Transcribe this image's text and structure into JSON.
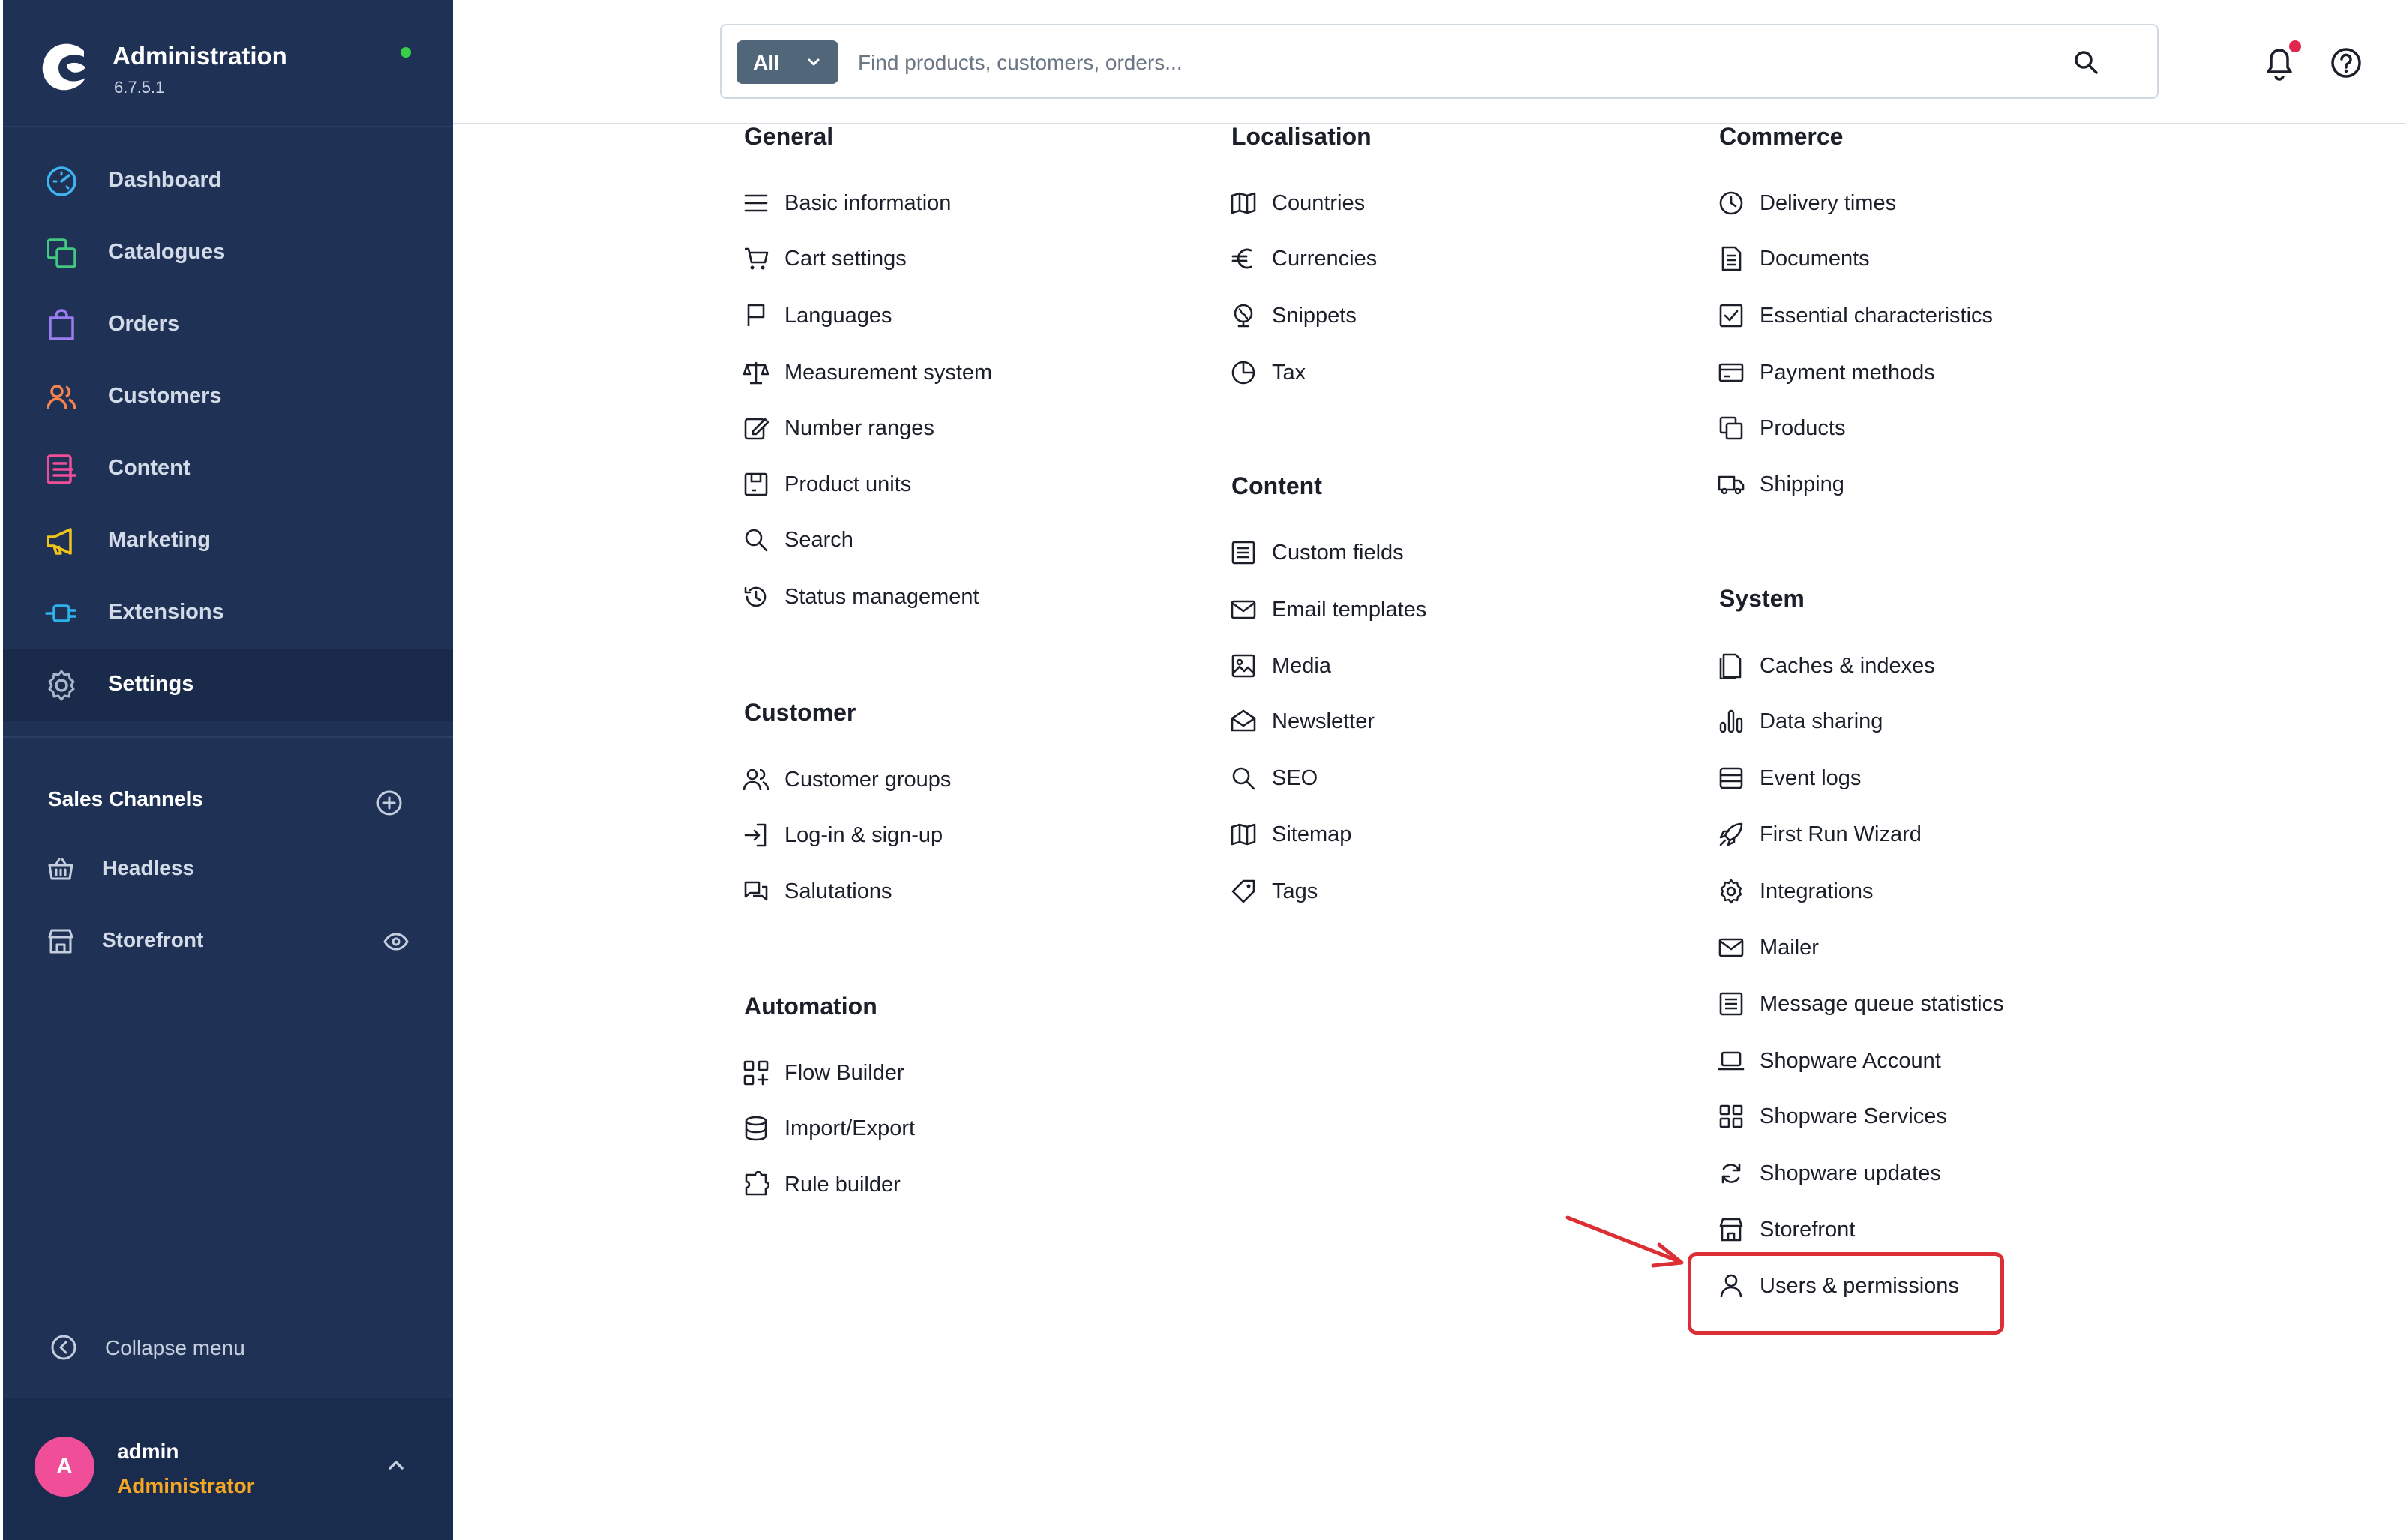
{
  "app": {
    "title": "Administration",
    "version": "6.7.5.1",
    "status_color": "#37d046",
    "logo_icon": "shopware-logo-icon"
  },
  "nav": {
    "items": [
      {
        "label": "Dashboard",
        "icon": "speedometer-icon",
        "color": "#3fb4f0"
      },
      {
        "label": "Catalogues",
        "icon": "catalogue-icon",
        "color": "#43c87f"
      },
      {
        "label": "Orders",
        "icon": "shopping-bag-icon",
        "color": "#9b7cf1"
      },
      {
        "label": "Customers",
        "icon": "users-icon",
        "color": "#f5834f"
      },
      {
        "label": "Content",
        "icon": "content-icon",
        "color": "#f04e98"
      },
      {
        "label": "Marketing",
        "icon": "megaphone-icon",
        "color": "#f0c518"
      },
      {
        "label": "Extensions",
        "icon": "plug-icon",
        "color": "#2db3ea"
      },
      {
        "label": "Settings",
        "icon": "gear-icon",
        "color": "#a9b5c9",
        "active": true
      }
    ]
  },
  "sales_channels": {
    "title": "Sales Channels",
    "add_icon": "plus-circle-icon",
    "items": [
      {
        "label": "Headless",
        "icon": "basket-icon"
      },
      {
        "label": "Storefront",
        "icon": "storefront-icon",
        "trailing_icon": "eye-icon"
      }
    ]
  },
  "collapse": {
    "label": "Collapse menu",
    "icon": "chevron-left-circle-icon"
  },
  "user": {
    "initial": "A",
    "name": "admin",
    "role": "Administrator",
    "avatar_color": "#f04e98",
    "role_color": "#f5a623"
  },
  "search": {
    "scope": "All",
    "placeholder": "Find products, customers, orders...",
    "value": ""
  },
  "header_icons": {
    "notifications": "bell-icon",
    "help": "help-icon"
  },
  "sections": {
    "general": {
      "title": "General",
      "items": [
        {
          "label": "Basic information",
          "icon": "menu-lines-icon"
        },
        {
          "label": "Cart settings",
          "icon": "cart-icon"
        },
        {
          "label": "Languages",
          "icon": "flag-icon"
        },
        {
          "label": "Measurement system",
          "icon": "scales-icon"
        },
        {
          "label": "Number ranges",
          "icon": "edit-note-icon"
        },
        {
          "label": "Product units",
          "icon": "product-box-icon"
        },
        {
          "label": "Search",
          "icon": "search-icon"
        },
        {
          "label": "Status management",
          "icon": "history-icon"
        }
      ]
    },
    "customer": {
      "title": "Customer",
      "items": [
        {
          "label": "Customer groups",
          "icon": "user-group-icon"
        },
        {
          "label": "Log-in & sign-up",
          "icon": "sign-in-icon"
        },
        {
          "label": "Salutations",
          "icon": "chat-bubbles-icon"
        }
      ]
    },
    "automation": {
      "title": "Automation",
      "items": [
        {
          "label": "Flow Builder",
          "icon": "flow-icon"
        },
        {
          "label": "Import/Export",
          "icon": "database-icon"
        },
        {
          "label": "Rule builder",
          "icon": "puzzle-icon"
        }
      ]
    },
    "localisation": {
      "title": "Localisation",
      "items": [
        {
          "label": "Countries",
          "icon": "map-icon"
        },
        {
          "label": "Currencies",
          "icon": "euro-icon"
        },
        {
          "label": "Snippets",
          "icon": "globe-icon"
        },
        {
          "label": "Tax",
          "icon": "pie-chart-icon"
        }
      ]
    },
    "content": {
      "title": "Content",
      "items": [
        {
          "label": "Custom fields",
          "icon": "list-box-icon"
        },
        {
          "label": "Email templates",
          "icon": "envelope-icon"
        },
        {
          "label": "Media",
          "icon": "image-icon"
        },
        {
          "label": "Newsletter",
          "icon": "envelope-open-icon"
        },
        {
          "label": "SEO",
          "icon": "search-icon"
        },
        {
          "label": "Sitemap",
          "icon": "map-icon"
        },
        {
          "label": "Tags",
          "icon": "tag-icon"
        }
      ]
    },
    "commerce": {
      "title": "Commerce",
      "items": [
        {
          "label": "Delivery times",
          "icon": "clock-icon"
        },
        {
          "label": "Documents",
          "icon": "document-icon"
        },
        {
          "label": "Essential characteristics",
          "icon": "checkbox-icon"
        },
        {
          "label": "Payment methods",
          "icon": "credit-card-icon"
        },
        {
          "label": "Products",
          "icon": "products-icon"
        },
        {
          "label": "Shipping",
          "icon": "truck-icon"
        }
      ]
    },
    "system": {
      "title": "System",
      "items": [
        {
          "label": "Caches & indexes",
          "icon": "cache-icon"
        },
        {
          "label": "Data sharing",
          "icon": "bar-chart-icon"
        },
        {
          "label": "Event logs",
          "icon": "database-icon"
        },
        {
          "label": "First Run Wizard",
          "icon": "rocket-icon"
        },
        {
          "label": "Integrations",
          "icon": "gear-icon"
        },
        {
          "label": "Mailer",
          "icon": "envelope-icon"
        },
        {
          "label": "Message queue statistics",
          "icon": "list-box-icon"
        },
        {
          "label": "Shopware Account",
          "icon": "laptop-icon"
        },
        {
          "label": "Shopware Services",
          "icon": "grid-icon"
        },
        {
          "label": "Shopware updates",
          "icon": "refresh-icon"
        },
        {
          "label": "Storefront",
          "icon": "storefront-icon"
        },
        {
          "label": "Users & permissions",
          "icon": "user-icon"
        }
      ]
    }
  },
  "annotation": {
    "color": "#dc2f35",
    "highlighted_item": "Users & permissions"
  }
}
